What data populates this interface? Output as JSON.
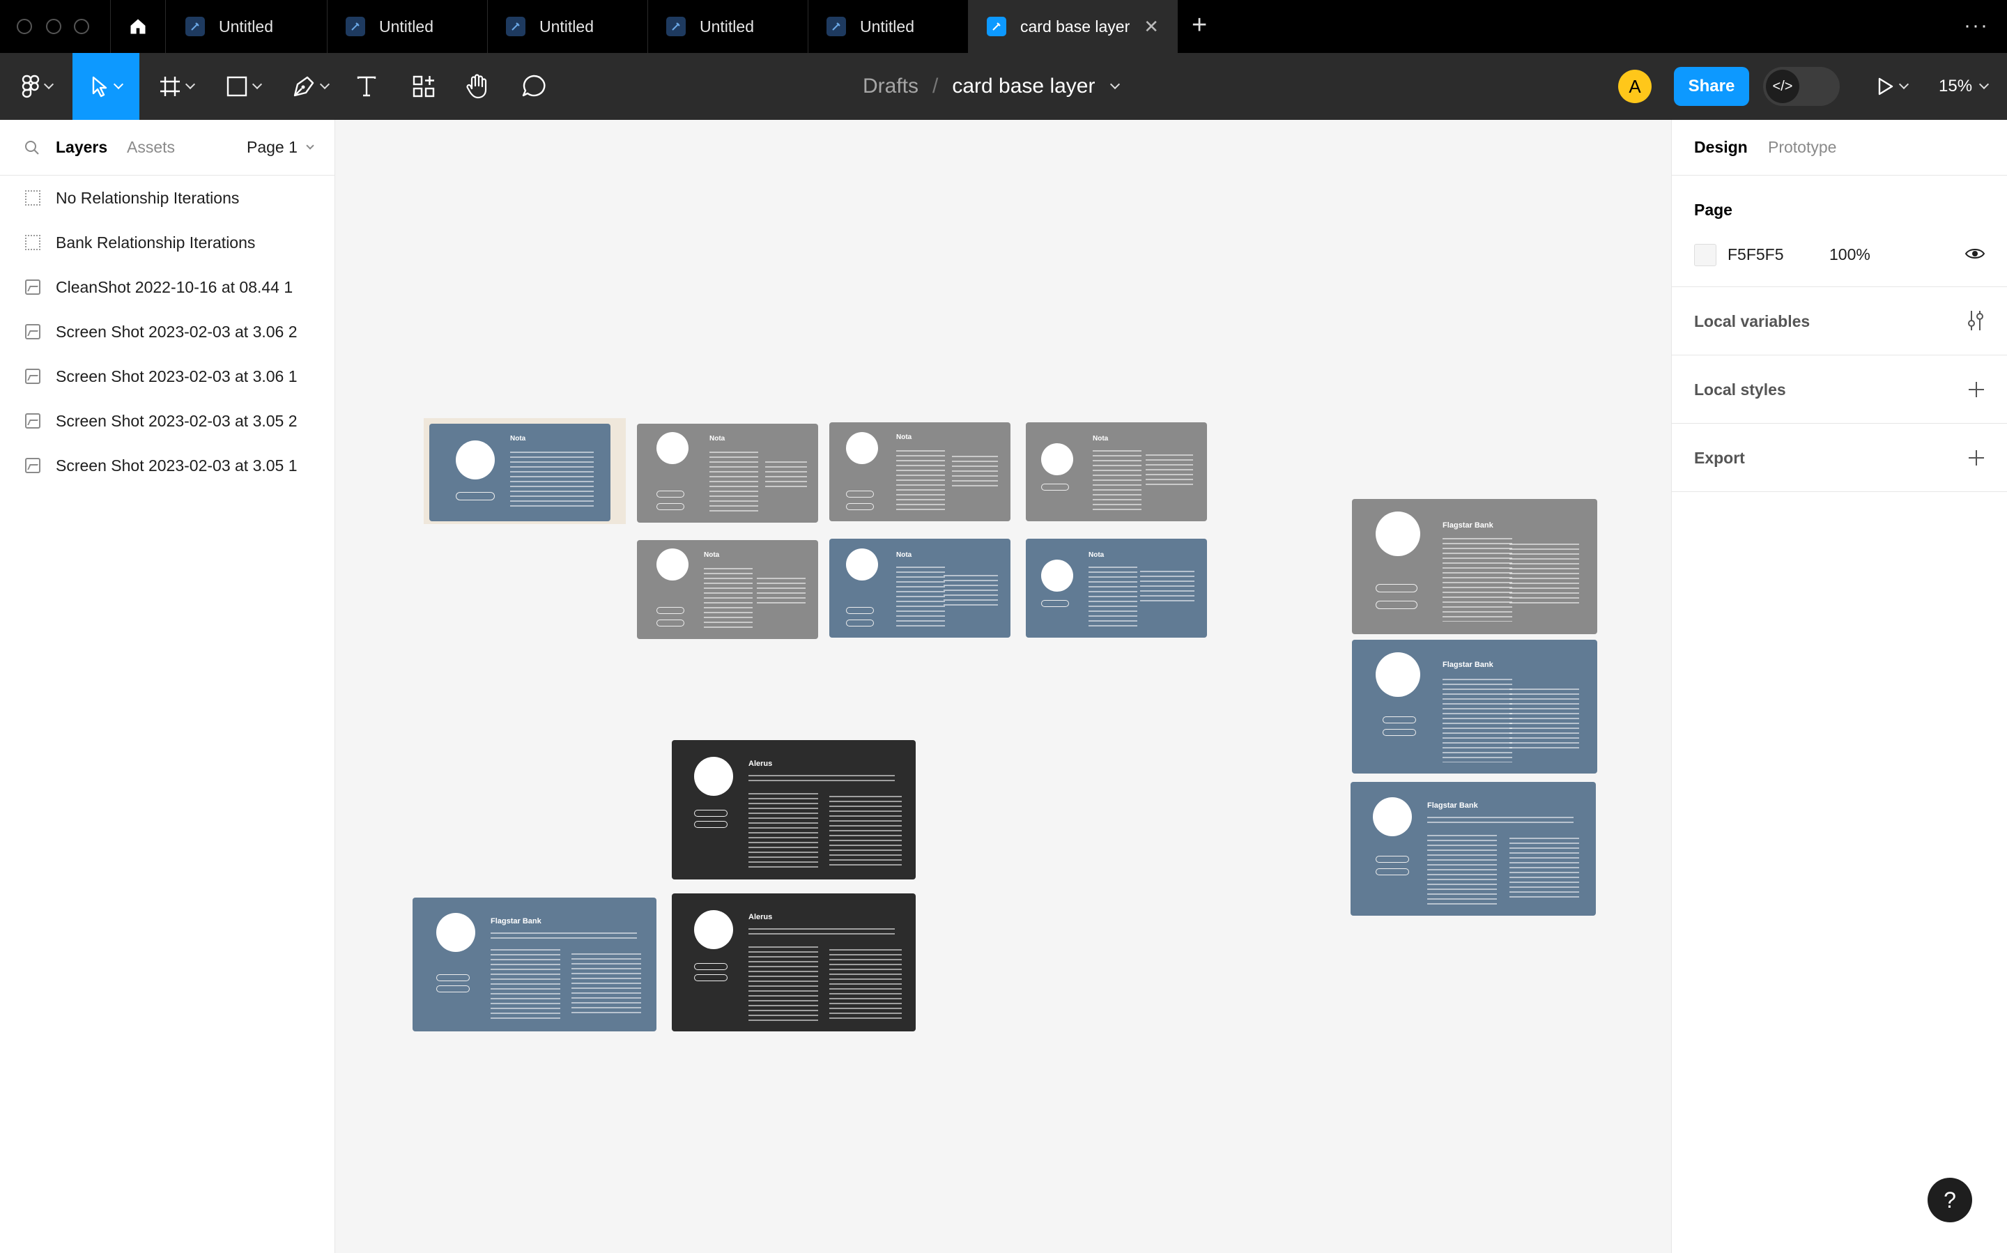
{
  "tabbar": {
    "tabs": [
      {
        "label": "Untitled",
        "active": false
      },
      {
        "label": "Untitled",
        "active": false
      },
      {
        "label": "Untitled",
        "active": false
      },
      {
        "label": "Untitled",
        "active": false
      },
      {
        "label": "Untitled",
        "active": false
      },
      {
        "label": "card base layer",
        "active": true
      }
    ],
    "close_glyph": "✕",
    "new_tab_glyph": "+",
    "more_glyph": "···"
  },
  "toolbar": {
    "breadcrumb_root": "Drafts",
    "breadcrumb_sep": "/",
    "file_name": "card base layer",
    "avatar_initial": "A",
    "share_label": "Share",
    "dev_mode_glyph": "</>",
    "zoom": "15%"
  },
  "left_panel": {
    "tabs": {
      "layers": "Layers",
      "assets": "Assets"
    },
    "page_selector": "Page 1",
    "layers": [
      {
        "label": "No Relationship Iterations",
        "icon": "frame-icon"
      },
      {
        "label": "Bank Relationship Iterations",
        "icon": "frame-icon"
      },
      {
        "label": "CleanShot 2022-10-16 at 08.44 1",
        "icon": "image-icon"
      },
      {
        "label": "Screen Shot 2023-02-03 at 3.06 2",
        "icon": "image-icon"
      },
      {
        "label": "Screen Shot 2023-02-03 at 3.06 1",
        "icon": "image-icon"
      },
      {
        "label": "Screen Shot 2023-02-03 at 3.05 2",
        "icon": "image-icon"
      },
      {
        "label": "Screen Shot 2023-02-03 at 3.05 1",
        "icon": "image-icon"
      }
    ]
  },
  "right_panel": {
    "tabs": {
      "design": "Design",
      "prototype": "Prototype"
    },
    "page_section": {
      "title": "Page",
      "color": "F5F5F5",
      "opacity": "100%"
    },
    "local_variables": "Local variables",
    "local_styles": "Local styles",
    "export": "Export"
  },
  "canvas": {
    "background": "#F5F5F5",
    "card_titles": {
      "nota": "Nota",
      "flagstar": "Flagstar Bank",
      "alerus": "Alerus"
    }
  },
  "colors": {
    "accent": "#0D99FF",
    "card_gray": "#8A8A8A",
    "card_blue": "#617B94",
    "card_dark": "#2C2C2C",
    "avatar": "#FFC71A"
  },
  "help_glyph": "?"
}
